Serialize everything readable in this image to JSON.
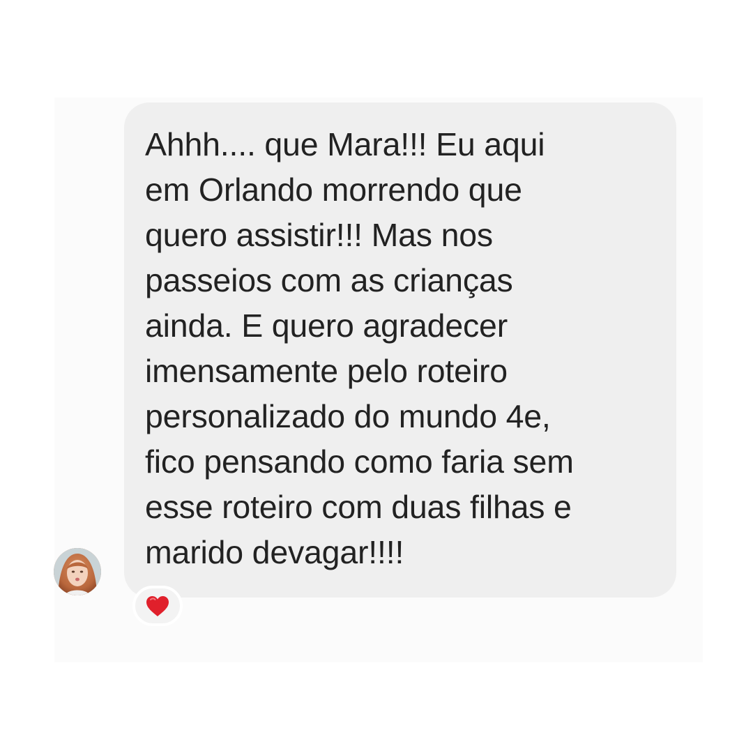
{
  "message": {
    "text": "Ahhh.... que Mara!!! Eu aqui\nem Orlando morrendo que\nquero assistir!!! Mas nos\npasseios com as crianças\nainda. E quero agradecer\nimensamente pelo roteiro\npersonalizado do mundo 4e,\nfico pensando como faria sem\nesse roteiro com duas filhas e\nmarido devagar!!!!",
    "reaction_icon": "red-heart",
    "reaction_color": "#e0202b"
  },
  "colors": {
    "bubble_background": "#efefef",
    "text": "#222222",
    "page_background": "#ffffff"
  }
}
